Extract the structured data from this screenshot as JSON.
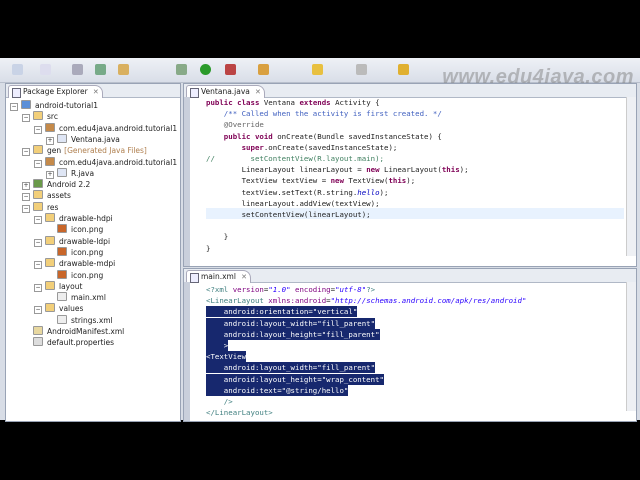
{
  "watermark": "www.edu4java.com",
  "package_explorer": {
    "title": "Package Explorer",
    "items": [
      {
        "label": "android-tutorial1",
        "depth": 0,
        "icon": "project-icon"
      },
      {
        "label": "src",
        "depth": 1,
        "icon": "folder-icon"
      },
      {
        "label": "com.edu4java.android.tutorial1",
        "depth": 2,
        "icon": "package-icon"
      },
      {
        "label": "Ventana.java",
        "depth": 3,
        "icon": "java-file-icon"
      },
      {
        "label": "gen",
        "extra": "[Generated Java Files]",
        "depth": 1,
        "icon": "folder-icon"
      },
      {
        "label": "com.edu4java.android.tutorial1",
        "depth": 2,
        "icon": "package-icon"
      },
      {
        "label": "R.java",
        "depth": 3,
        "icon": "java-file-icon"
      },
      {
        "label": "Android 2.2",
        "depth": 1,
        "icon": "library-icon"
      },
      {
        "label": "assets",
        "depth": 1,
        "icon": "folder-icon"
      },
      {
        "label": "res",
        "depth": 1,
        "icon": "folder-icon"
      },
      {
        "label": "drawable-hdpi",
        "depth": 2,
        "icon": "folder-icon"
      },
      {
        "label": "icon.png",
        "depth": 3,
        "icon": "image-file-icon"
      },
      {
        "label": "drawable-ldpi",
        "depth": 2,
        "icon": "folder-icon"
      },
      {
        "label": "icon.png",
        "depth": 3,
        "icon": "image-file-icon"
      },
      {
        "label": "drawable-mdpi",
        "depth": 2,
        "icon": "folder-icon"
      },
      {
        "label": "icon.png",
        "depth": 3,
        "icon": "image-file-icon"
      },
      {
        "label": "layout",
        "depth": 2,
        "icon": "folder-icon"
      },
      {
        "label": "main.xml",
        "depth": 3,
        "icon": "xml-file-icon"
      },
      {
        "label": "values",
        "depth": 2,
        "icon": "folder-icon"
      },
      {
        "label": "strings.xml",
        "depth": 3,
        "icon": "xml-file-icon"
      },
      {
        "label": "AndroidManifest.xml",
        "depth": 1,
        "icon": "manifest-file-icon"
      },
      {
        "label": "default.properties",
        "depth": 1,
        "icon": "properties-file-icon"
      }
    ]
  },
  "java_editor": {
    "tab": "Ventana.java",
    "lines": [
      [
        [
          "kw",
          "public class "
        ],
        [
          "",
          "Ventana "
        ],
        [
          "kw",
          "extends "
        ],
        [
          "",
          "Activity {"
        ]
      ],
      [
        [
          "cm",
          "    /** Called when the activity is first created. */"
        ]
      ],
      [
        [
          "an",
          "    @Override"
        ]
      ],
      [
        [
          "kw",
          "    public void "
        ],
        [
          "",
          "onCreate(Bundle savedInstanceState) {"
        ]
      ],
      [
        [
          "kw",
          "        super"
        ],
        [
          "",
          ".onCreate(savedInstanceState);"
        ]
      ],
      [
        [
          "lc",
          "//        setContentView(R.layout.main);"
        ]
      ],
      [
        [
          "",
          "        LinearLayout linearLayout = "
        ],
        [
          "kw",
          "new "
        ],
        [
          "",
          "LinearLayout("
        ],
        [
          "kw",
          "this"
        ],
        [
          "",
          ");"
        ]
      ],
      [
        [
          "",
          "        TextView textView = "
        ],
        [
          "kw",
          "new "
        ],
        [
          "",
          "TextView("
        ],
        [
          "kw",
          "this"
        ],
        [
          "",
          ");"
        ]
      ],
      [
        [
          "",
          "        textView.setText(R.string."
        ],
        [
          "fd",
          "hello"
        ],
        [
          "",
          ");"
        ]
      ],
      [
        [
          "",
          "        linearLayout.addView(textView);"
        ]
      ],
      [
        [
          "",
          "        setContentView(linearLayout);"
        ]
      ],
      [
        [
          "",
          ""
        ]
      ],
      [
        [
          "",
          "    }"
        ]
      ],
      [
        [
          "",
          "}"
        ]
      ]
    ]
  },
  "xml_editor": {
    "tab": "main.xml",
    "lines": [
      [
        [
          "tag",
          "<?xml "
        ],
        [
          "at",
          "version"
        ],
        [
          "",
          "="
        ],
        [
          "av",
          "\"1.0\""
        ],
        [
          "at",
          " encoding"
        ],
        [
          "",
          "="
        ],
        [
          "av",
          "\"utf-8\""
        ],
        [
          "tag",
          "?>"
        ]
      ],
      [
        [
          "tag",
          "<LinearLayout "
        ],
        [
          "at",
          "xmlns:android"
        ],
        [
          "",
          "="
        ],
        [
          "av",
          "\"http://schemas.android.com/apk/res/android\""
        ]
      ],
      [
        [
          "",
          "    android:orientation=\"vertical\""
        ]
      ],
      [
        [
          "",
          "    android:layout_width=\"fill_parent\""
        ]
      ],
      [
        [
          "",
          "    android:layout_height=\"fill_parent\""
        ]
      ],
      [
        [
          "",
          "    >"
        ]
      ],
      [
        [
          "",
          "<TextView"
        ]
      ],
      [
        [
          "",
          "    android:layout_width=\"fill_parent\""
        ]
      ],
      [
        [
          "",
          "    android:layout_height=\"wrap_content\""
        ]
      ],
      [
        [
          "",
          "    android:text=\"@string/hello\""
        ]
      ],
      [
        [
          "tag",
          "    />"
        ]
      ],
      [
        [
          "tag",
          "</LinearLayout>"
        ]
      ]
    ]
  }
}
